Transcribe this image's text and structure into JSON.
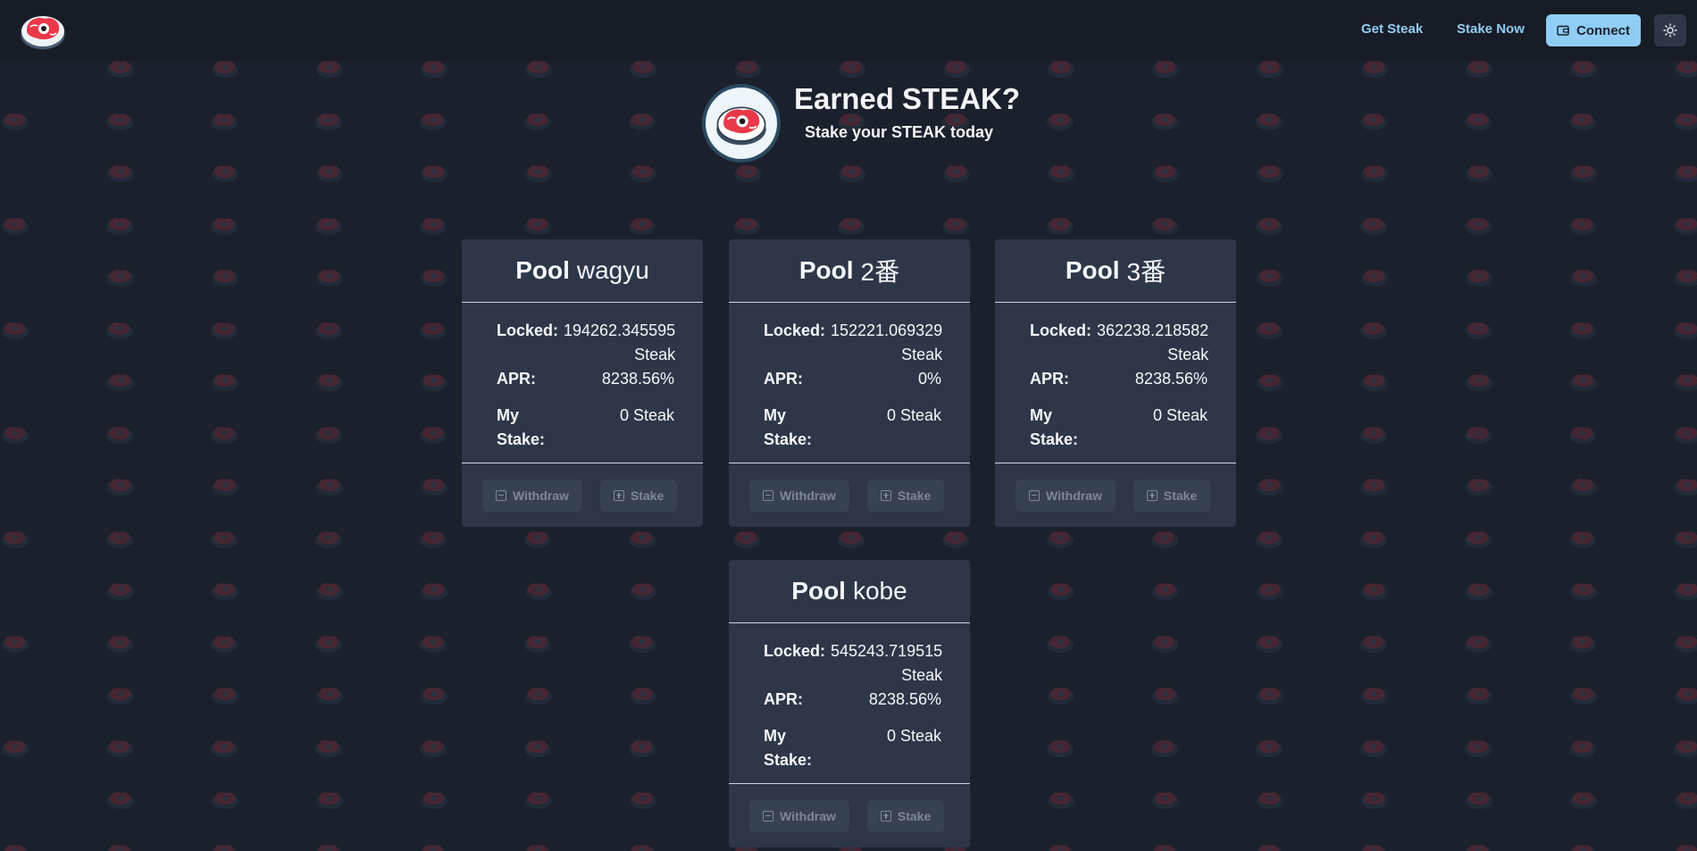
{
  "header": {
    "logo_icon": "steak-logo-icon",
    "nav": [
      {
        "label": "Get Steak"
      },
      {
        "label": "Stake Now"
      }
    ],
    "connect_label": "Connect",
    "connect_icon": "wallet-icon",
    "theme_icon": "sun-icon"
  },
  "hero": {
    "title": "Earned STEAK?",
    "subtitle": "Stake your STEAK today",
    "icon": "steak-logo-icon"
  },
  "colors": {
    "background": "#1a202c",
    "card": "#2d3748",
    "accent": "#90cdf4",
    "steak_red": "#e53e3e"
  },
  "pools": [
    {
      "pool_word": "Pool",
      "name": "wagyu",
      "locked_label": "Locked:",
      "locked_value": "194262.345595",
      "locked_unit": "Steak",
      "apr_label": "APR:",
      "apr_value": "8238.56%",
      "stake_label_1": "My",
      "stake_label_2": "Stake:",
      "stake_value": "0 Steak",
      "withdraw_label": "Withdraw",
      "stake_btn_label": "Stake"
    },
    {
      "pool_word": "Pool",
      "name": "2番",
      "locked_label": "Locked:",
      "locked_value": "152221.069329",
      "locked_unit": "Steak",
      "apr_label": "APR:",
      "apr_value": "0%",
      "stake_label_1": "My",
      "stake_label_2": "Stake:",
      "stake_value": "0 Steak",
      "withdraw_label": "Withdraw",
      "stake_btn_label": "Stake"
    },
    {
      "pool_word": "Pool",
      "name": "3番",
      "locked_label": "Locked:",
      "locked_value": "362238.218582",
      "locked_unit": "Steak",
      "apr_label": "APR:",
      "apr_value": "8238.56%",
      "stake_label_1": "My",
      "stake_label_2": "Stake:",
      "stake_value": "0 Steak",
      "withdraw_label": "Withdraw",
      "stake_btn_label": "Stake"
    },
    {
      "pool_word": "Pool",
      "name": "kobe",
      "locked_label": "Locked:",
      "locked_value": "545243.719515",
      "locked_unit": "Steak",
      "apr_label": "APR:",
      "apr_value": "8238.56%",
      "stake_label_1": "My",
      "stake_label_2": "Stake:",
      "stake_value": "0 Steak",
      "withdraw_label": "Withdraw",
      "stake_btn_label": "Stake"
    }
  ]
}
